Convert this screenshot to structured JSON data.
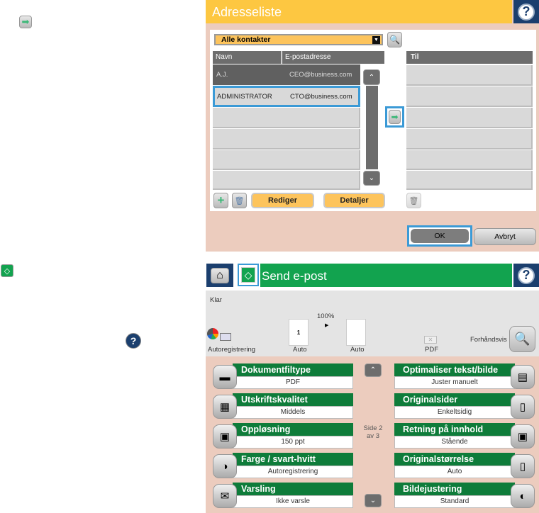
{
  "address_list": {
    "title": "Adresseliste",
    "help_icon": "?",
    "filter_value": "Alle kontakter",
    "columns": {
      "name": "Navn",
      "email": "E-postadresse",
      "to": "Til"
    },
    "contacts": [
      {
        "name": "A.J.",
        "email": "CEO@business.com"
      },
      {
        "name": "ADMINISTRATOR",
        "email": "CTO@business.com"
      }
    ],
    "buttons": {
      "edit": "Rediger",
      "details": "Detaljer",
      "ok": "OK",
      "cancel": "Avbryt"
    }
  },
  "send_email": {
    "title": "Send e-post",
    "help_icon": "?",
    "status": "Klar",
    "color_mode": "Autoregistrering",
    "scale": "100%",
    "original_label": "Auto",
    "original_page": "1",
    "output_label": "Auto",
    "file_format": "PDF",
    "preview_label": "Forhåndsvis",
    "page_indicator": {
      "line1": "Side 2",
      "line2": "av 3"
    },
    "options_left": [
      {
        "title": "Dokumentfiltype",
        "value": "PDF"
      },
      {
        "title": "Utskriftskvalitet",
        "value": "Middels"
      },
      {
        "title": "Oppløsning",
        "value": "150 ppt"
      },
      {
        "title": "Farge / svart-hvitt",
        "value": "Autoregistrering"
      },
      {
        "title": "Varsling",
        "value": "Ikke varsle"
      }
    ],
    "options_right": [
      {
        "title": "Optimaliser tekst/bilde",
        "value": "Juster manuelt"
      },
      {
        "title": "Originalsider",
        "value": "Enkeltsidig"
      },
      {
        "title": "Retning på innhold",
        "value": "Stående"
      },
      {
        "title": "Originalstørrelse",
        "value": "Auto"
      },
      {
        "title": "Bildejustering",
        "value": "Standard"
      }
    ]
  },
  "legend": {
    "help_icon": "?"
  },
  "colors": {
    "yellow": "#fdc741",
    "green": "#12a34f",
    "dark_green": "#0e7c3a",
    "blue": "#1b3f6e",
    "highlight": "#3b9ad6"
  }
}
